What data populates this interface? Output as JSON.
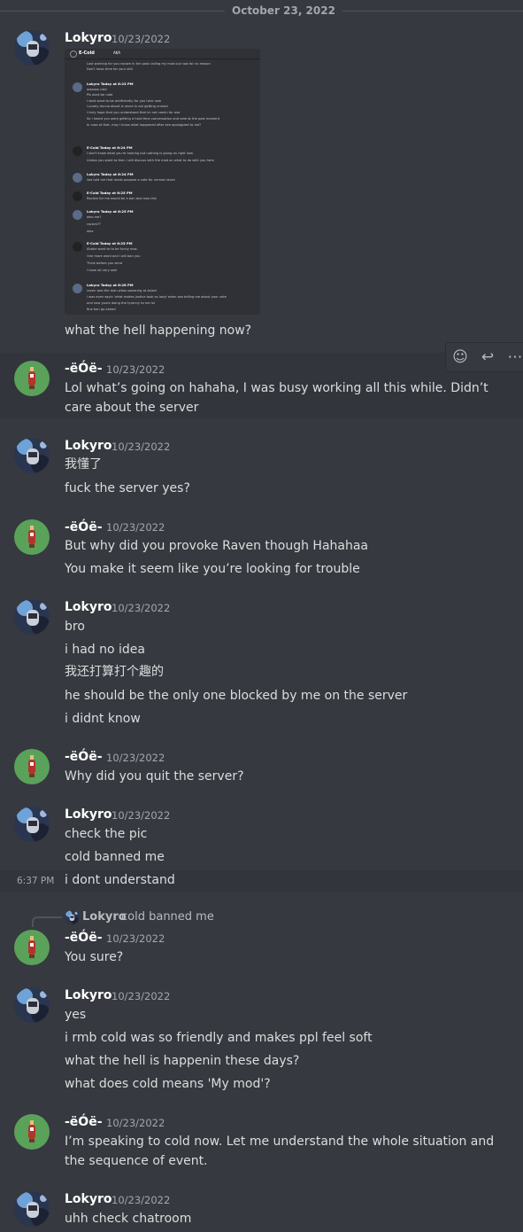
{
  "divider": {
    "date": "October 23, 2022"
  },
  "toolbar": {
    "add_reaction": "add reaction",
    "reply": "reply",
    "more": "more"
  },
  "screenshot_embed": {
    "header_name": "E-Cold",
    "header_tag": "AKA",
    "lines": [
      "Last warning for you racism in the past calling my mod out now for no reason",
      "Don't have time for your shit",
      "Lokyro  Today at 6:23 PM",
      "awwww cold",
      "Pls dont be rude",
      "I dont want to be antifriendly for you here now",
      "I purely dunno about is raven is not getting unmod",
      "I truly hope that you understand that im not comin for war",
      "So i heard you were getting a hard time conversation and vote at the past moment",
      "In case of that, may i know what happened after see apologized to me?",
      "E-Cold  Today at 6:24 PM",
      "I don't know what you're hearing but nothing is going on right now",
      "Unless you want to then i will discuss with the mod on what to do with you here",
      "Lokyro  Today at 6:24 PM",
      "sea told me that mods propose a vote for unmod raven",
      "E-Cold  Today at 6:25 PM",
      "Racism for me would be a ban and now this",
      "Lokyro  Today at 6:25 PM",
      "who me?",
      "racism??",
      "wha",
      "E-Cold  Today at 6:25 PM",
      "Ahaha want to to be funny now..",
      "One more word and i will ban you",
      "Think before you send",
      "I have alt very well",
      "Lokyro  Today at 6:26 PM",
      "raven was the man whos swearing at Asian!",
      "i was even sayin 'what makes justice took so long' when sea telling me about your vote",
      "and now youre doing the tyranny to me lol",
      "fine ban go ahead"
    ]
  },
  "messages": [
    {
      "author": "Lokyro",
      "timestamp": "10/23/2022",
      "lines": [
        "what the hell happening now?"
      ]
    },
    {
      "author": "-ëÓë-",
      "timestamp": "10/23/2022",
      "lines": [
        "Lol what’s going on hahaha, I was busy working all this while. Didn’t care about the server"
      ]
    },
    {
      "author": "Lokyro",
      "timestamp": "10/23/2022",
      "lines": [
        "我懂了",
        "fuck the server yes?"
      ]
    },
    {
      "author": "-ëÓë-",
      "timestamp": "10/23/2022",
      "lines": [
        "But why did you provoke Raven though Hahahaa",
        "You make it seem like you’re looking for trouble"
      ]
    },
    {
      "author": "Lokyro",
      "timestamp": "10/23/2022",
      "lines": [
        "bro",
        "i had no idea",
        "我还打算打个趣的",
        "he should be the only one blocked by me on the server",
        "i didnt know"
      ]
    },
    {
      "author": "-ëÓë-",
      "timestamp": "10/23/2022",
      "lines": [
        "Why did you quit the server?"
      ]
    },
    {
      "author": "Lokyro",
      "timestamp": "10/23/2022",
      "lines": [
        "check the pic",
        "cold banned me",
        "i dont understand"
      ],
      "hover_time": "6:37 PM"
    },
    {
      "author": "-ëÓë-",
      "timestamp": "10/23/2022",
      "reply": {
        "author": "Lokyro",
        "text": "cold banned me"
      },
      "lines": [
        "You sure?"
      ]
    },
    {
      "author": "Lokyro",
      "timestamp": "10/23/2022",
      "lines": [
        "yes",
        "i rmb cold was so friendly and makes ppl feel soft",
        "what the hell is happenin these days?",
        "what does cold means 'My mod'?"
      ]
    },
    {
      "author": "-ëÓë-",
      "timestamp": "10/23/2022",
      "lines": [
        "I’m speaking to cold now. Let me understand the whole situation and the sequence of event."
      ]
    },
    {
      "author": "Lokyro",
      "timestamp": "10/23/2022",
      "lines": [
        "uhh check chatroom"
      ]
    }
  ],
  "colors": {
    "background": "#36393f",
    "highlight": "#32353b",
    "green_avatar": "#5aa15a"
  }
}
